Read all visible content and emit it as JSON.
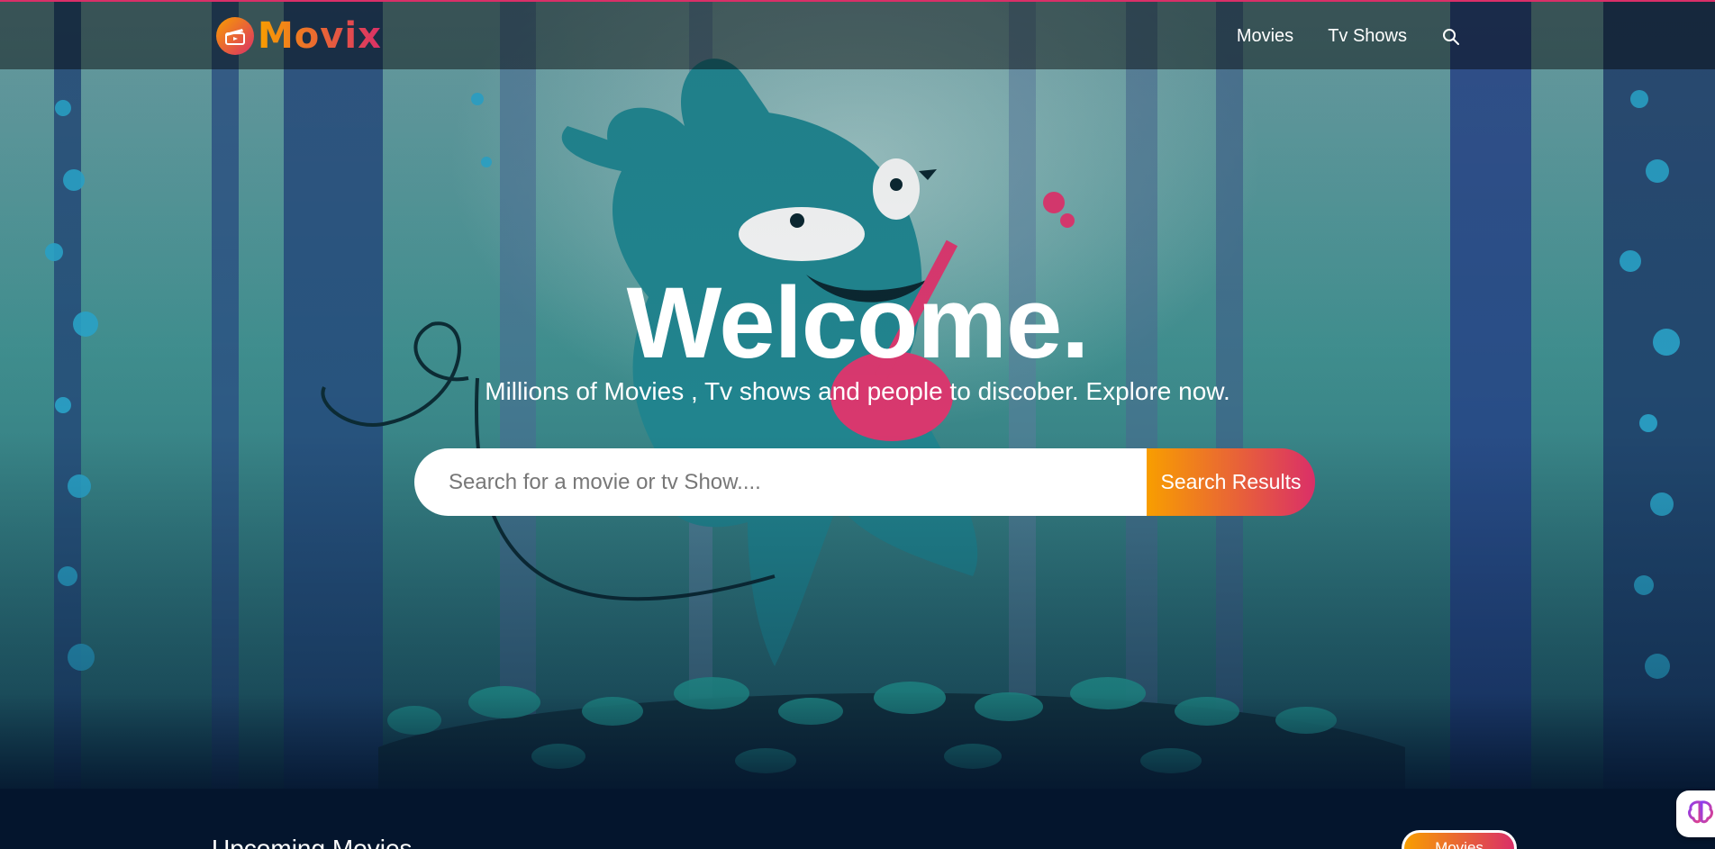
{
  "header": {
    "logo_text": "Movix",
    "nav": [
      {
        "label": "Movies"
      },
      {
        "label": "Tv Shows"
      }
    ]
  },
  "hero": {
    "title": "Welcome.",
    "subtitle": "Millions of Movies , Tv shows and people to discober. Explore now.",
    "search": {
      "placeholder": "Search for a movie or tv Show....",
      "value": "",
      "button_label": "Search Results"
    }
  },
  "section": {
    "title": "Upcoming Movies",
    "switch_options": [
      "Movies"
    ],
    "active_option": "Movies"
  },
  "colors": {
    "accent_start": "#f89e00",
    "accent_end": "#da2f68",
    "page_bg": "#04152d"
  },
  "icons": [
    "clapperboard-icon",
    "search-icon",
    "brain-icon"
  ]
}
